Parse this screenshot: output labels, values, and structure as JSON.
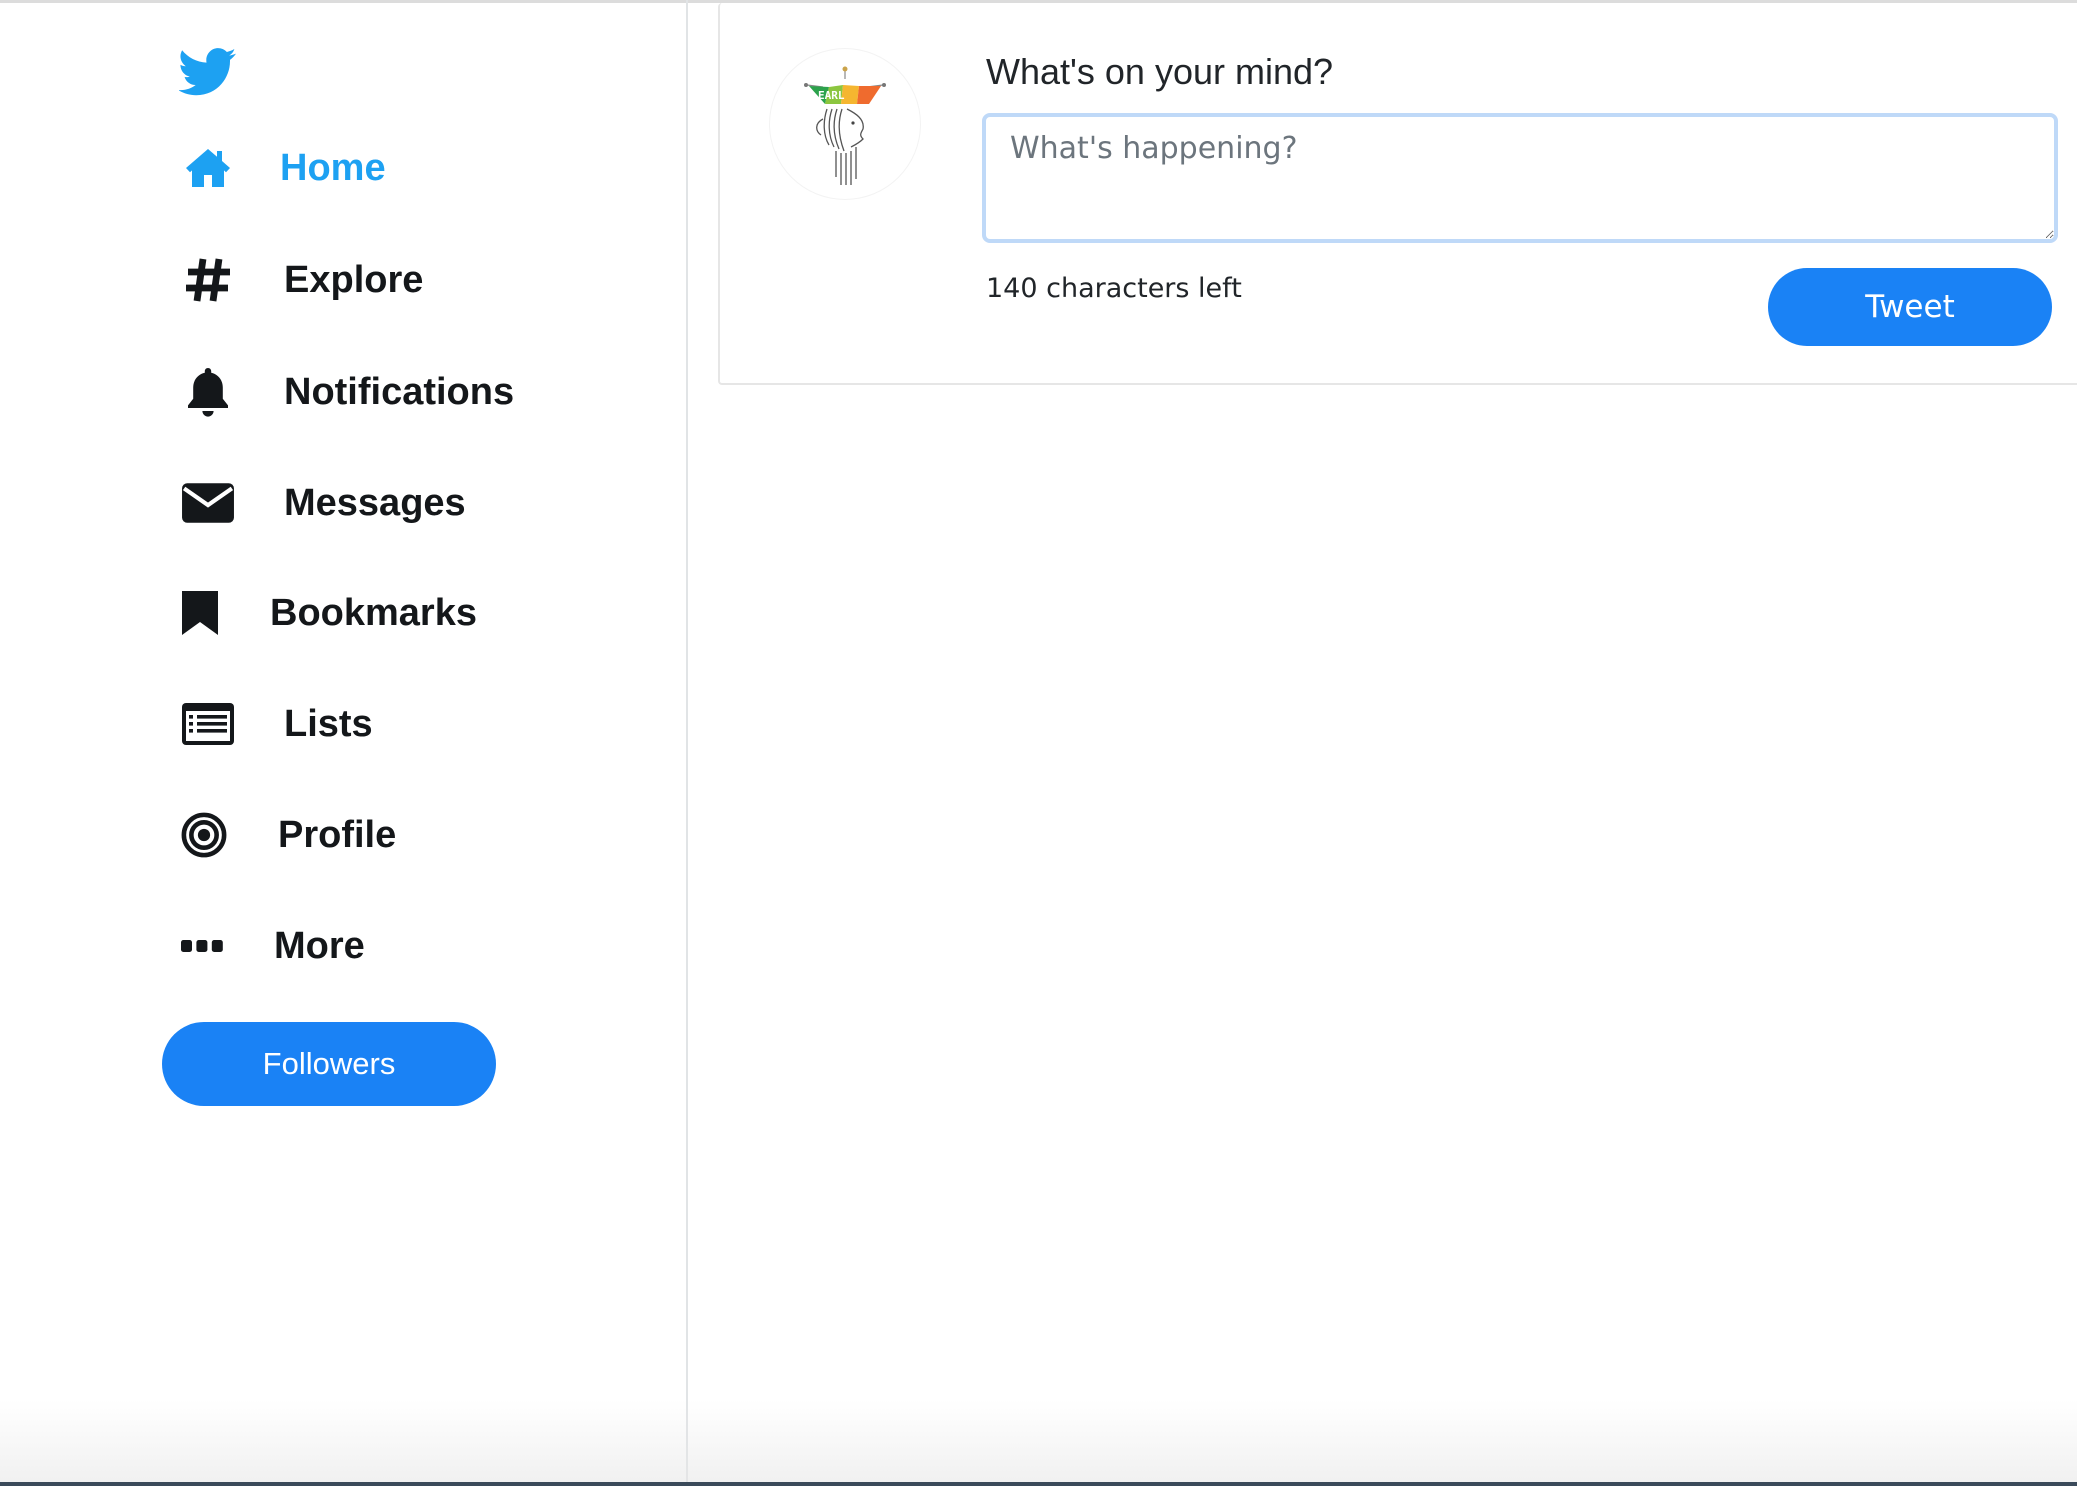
{
  "app": {
    "logo_icon": "twitter-bird-icon",
    "accent_color": "#1da1f2",
    "button_color": "#1a82f5"
  },
  "sidebar": {
    "items": [
      {
        "label": "Home",
        "icon": "home-icon",
        "active": true
      },
      {
        "label": "Explore",
        "icon": "hashtag-icon",
        "active": false
      },
      {
        "label": "Notifications",
        "icon": "bell-icon",
        "active": false
      },
      {
        "label": "Messages",
        "icon": "envelope-icon",
        "active": false
      },
      {
        "label": "Bookmarks",
        "icon": "bookmark-icon",
        "active": false
      },
      {
        "label": "Lists",
        "icon": "list-icon",
        "active": false
      },
      {
        "label": "Profile",
        "icon": "target-icon",
        "active": false
      },
      {
        "label": "More",
        "icon": "ellipsis-icon",
        "active": false
      }
    ],
    "followers_button": "Followers"
  },
  "composer": {
    "avatar_text": "EARL",
    "prompt": "What's on your mind?",
    "input_placeholder": "What's happening?",
    "input_value": "",
    "chars_left": "140 characters left",
    "tweet_button": "Tweet"
  }
}
